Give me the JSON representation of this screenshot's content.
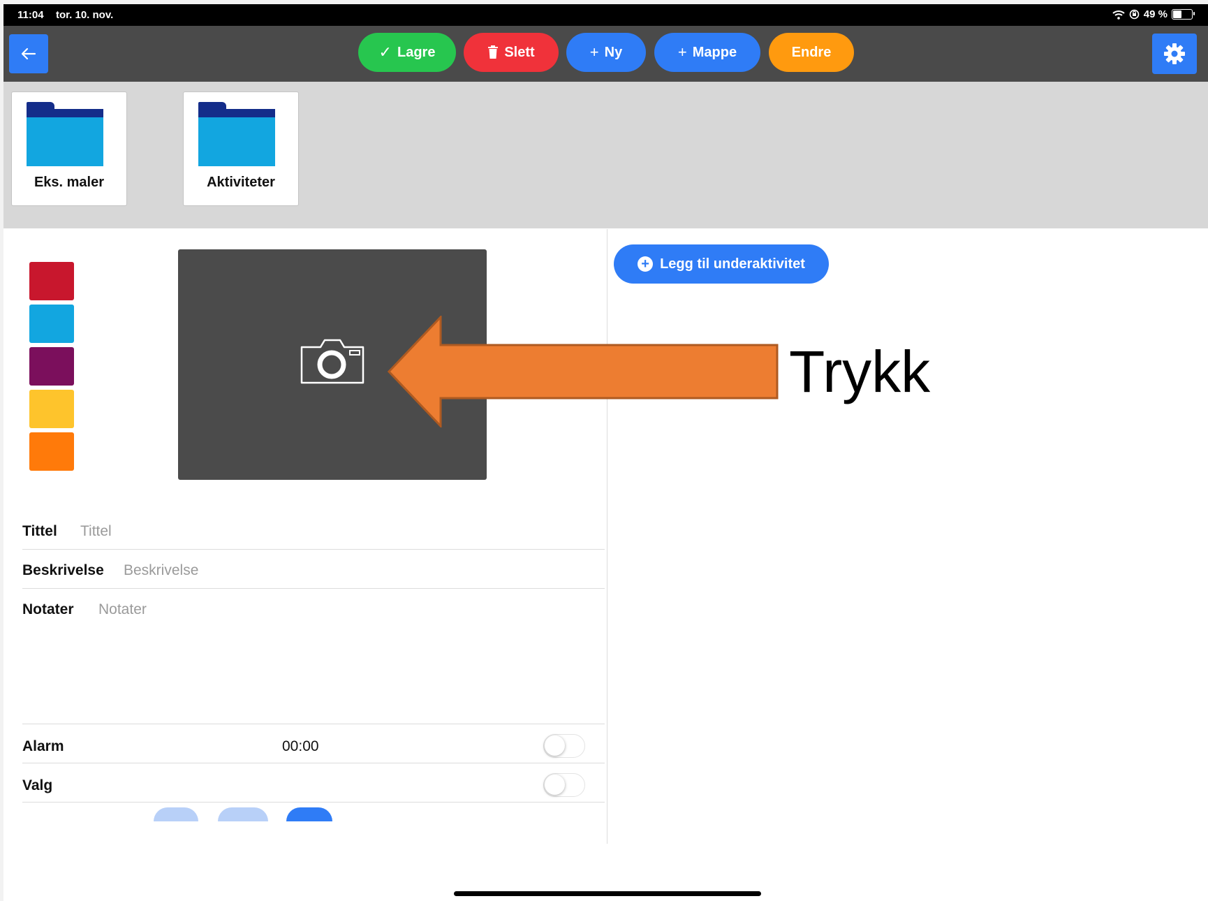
{
  "status_bar": {
    "time": "11:04",
    "date": "tor. 10. nov.",
    "battery": "49 %"
  },
  "toolbar": {
    "back_icon": "arrow-left-icon",
    "settings_icon": "gear-icon",
    "buttons": {
      "save": {
        "label": "Lagre",
        "glyph": "✓",
        "color": "#27c64f"
      },
      "delete": {
        "label": "Slett",
        "color": "#f0323a"
      },
      "new": {
        "label": "Ny",
        "glyph": "+",
        "color": "#2f7cf6"
      },
      "folder": {
        "label": "Mappe",
        "glyph": "+",
        "color": "#2f7cf6"
      },
      "edit": {
        "label": "Endre",
        "color": "#ff9a0f"
      }
    }
  },
  "folders": [
    {
      "label": "Eks. maler"
    },
    {
      "label": "Aktiviteter"
    }
  ],
  "color_swatches": [
    "#c8172d",
    "#12a6e0",
    "#7b0f5c",
    "#fec42c",
    "#ff7a0a"
  ],
  "photo_picker": {
    "icon": "camera-icon"
  },
  "form": {
    "title": {
      "label": "Tittel",
      "placeholder": "Tittel"
    },
    "description": {
      "label": "Beskrivelse",
      "placeholder": "Beskrivelse"
    },
    "notes": {
      "label": "Notater",
      "placeholder": "Notater"
    },
    "alarm": {
      "label": "Alarm",
      "time": "00:00",
      "enabled": false
    },
    "choice": {
      "label": "Valg",
      "enabled": false
    }
  },
  "subactivity": {
    "add_label": "Legg til underaktivitet"
  },
  "annotation": {
    "text": "Trykk",
    "arrow_color": "#ed7d31"
  }
}
